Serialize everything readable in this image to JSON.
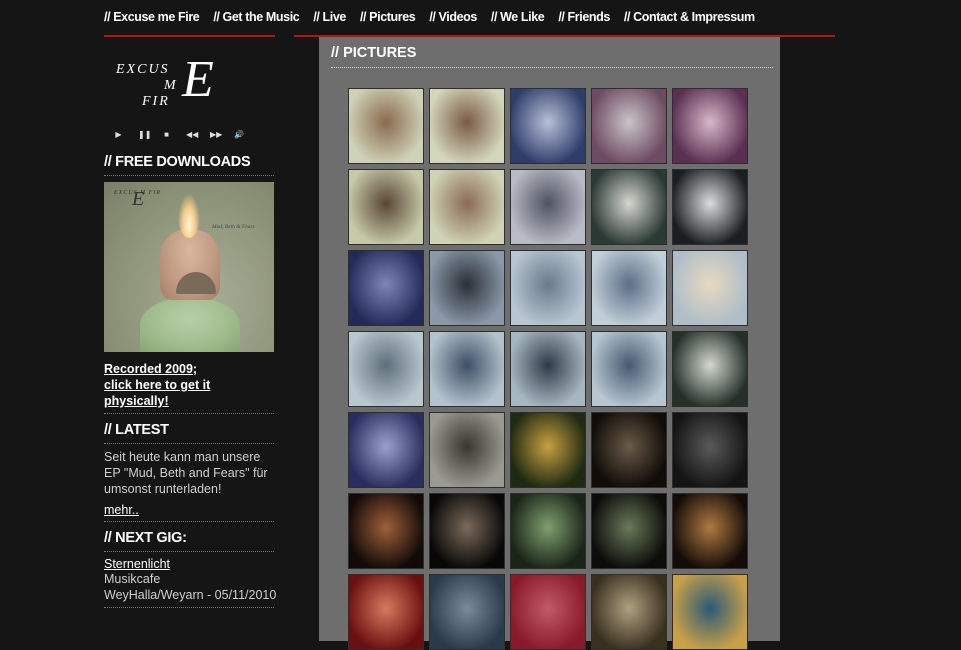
{
  "nav": {
    "items": [
      "// Excuse me Fire",
      "// Get the Music",
      "// Live",
      "// Pictures",
      "// Videos",
      "// We Like",
      "// Friends",
      "// Contact & Impressum"
    ]
  },
  "logo": {
    "line1": "EXCUS",
    "line2": "M",
    "line3": "FIR",
    "big": "E"
  },
  "player": {
    "icons": [
      "play-icon",
      "pause-icon",
      "stop-icon",
      "previous-icon",
      "next-icon",
      "volume-icon"
    ],
    "glyphs": [
      "▶",
      "❚❚",
      "■",
      "◀◀",
      "▶▶",
      "🔊"
    ]
  },
  "downloads": {
    "heading": "// FREE DOWNLOADS",
    "album_logo_small": "EXCUS M FIR",
    "album_logo_E": "E",
    "album_title": "Mud, Beth & Fears",
    "link_line1": "Recorded 2009;",
    "link_line2": "click here to get it",
    "link_line3": "physically!"
  },
  "latest": {
    "heading": "// LATEST",
    "text": "Seit heute kann man unsere EP \"Mud, Beth and Fears\" für umsonst runterladen!",
    "more": "mehr.."
  },
  "gig": {
    "heading": "// NEXT GIG:",
    "name": "Sternenlicht",
    "venue": "Musikcafe",
    "place": "WeyHalla/Weyarn - 05/11/2010"
  },
  "main": {
    "title": "// PICTURES",
    "thumbs": [
      {
        "a": "#cfd2b8",
        "b": "#8b6a4e"
      },
      {
        "a": "#d4d6bc",
        "b": "#7a5a45"
      },
      {
        "a": "#2f3d6a",
        "b": "#b8c0d8"
      },
      {
        "a": "#6e4b62",
        "b": "#c9c4c8"
      },
      {
        "a": "#5a2f52",
        "b": "#d7b8c8"
      },
      {
        "a": "#c7caa8",
        "b": "#5a4636"
      },
      {
        "a": "#d0d3b6",
        "b": "#8a6a55"
      },
      {
        "a": "#b9bcc6",
        "b": "#4f5260"
      },
      {
        "a": "#2c3a35",
        "b": "#d6d6d0"
      },
      {
        "a": "#1b1f22",
        "b": "#d9dde0"
      },
      {
        "a": "#242a58",
        "b": "#7d86b8"
      },
      {
        "a": "#8a98a8",
        "b": "#2b3038"
      },
      {
        "a": "#b8c6d2",
        "b": "#6a7a8a"
      },
      {
        "a": "#c2cfd8",
        "b": "#5b6f86"
      },
      {
        "a": "#aebdc8",
        "b": "#e8d9c0"
      },
      {
        "a": "#b9c7cf",
        "b": "#5e6e7a"
      },
      {
        "a": "#b3c2cc",
        "b": "#3f4f66"
      },
      {
        "a": "#a7b7c2",
        "b": "#2f3b48"
      },
      {
        "a": "#b7c6d0",
        "b": "#465a70"
      },
      {
        "a": "#243028",
        "b": "#d4d8d0"
      },
      {
        "a": "#2a2d5e",
        "b": "#9aa0cc"
      },
      {
        "a": "#9a9a92",
        "b": "#3a3530"
      },
      {
        "a": "#1f2a12",
        "b": "#c8a040"
      },
      {
        "a": "#100c08",
        "b": "#6a5a48"
      },
      {
        "a": "#141414",
        "b": "#5a5a5a"
      },
      {
        "a": "#120a08",
        "b": "#a0603a"
      },
      {
        "a": "#080808",
        "b": "#7a6a5a"
      },
      {
        "a": "#1a2418",
        "b": "#7fa070"
      },
      {
        "a": "#0c0c0a",
        "b": "#6a7a5a"
      },
      {
        "a": "#140c08",
        "b": "#b07a40"
      },
      {
        "a": "#6a1010",
        "b": "#d87a60"
      },
      {
        "a": "#2a3a4a",
        "b": "#7a8a9a"
      },
      {
        "a": "#8a1a2a",
        "b": "#c05a6a"
      },
      {
        "a": "#3a3020",
        "b": "#b0a080"
      },
      {
        "a": "#c8a048",
        "b": "#2a5a78"
      }
    ]
  }
}
